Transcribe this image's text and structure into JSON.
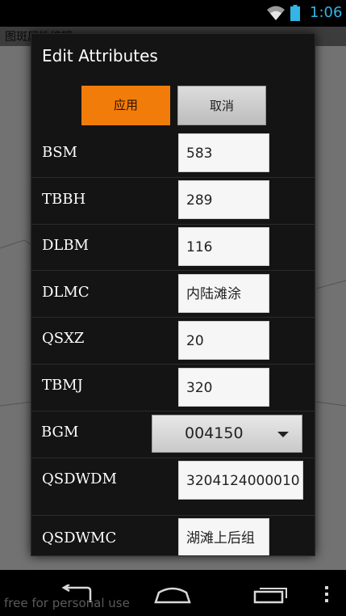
{
  "status_bar": {
    "time": "1:06",
    "icons": [
      "wifi-icon",
      "battery-icon"
    ]
  },
  "background_app": {
    "title": "图斑属性编辑"
  },
  "dialog": {
    "title": "Edit Attributes",
    "apply_label": "应用",
    "cancel_label": "取消",
    "fields": [
      {
        "label": "BSM",
        "value": "583"
      },
      {
        "label": "TBBH",
        "value": "289"
      },
      {
        "label": "DLBM",
        "value": "116"
      },
      {
        "label": "DLMC",
        "value": "内陆滩涂"
      },
      {
        "label": "QSXZ",
        "value": "20"
      },
      {
        "label": "TBMJ",
        "value": "320"
      },
      {
        "label": "BGM",
        "value": "004150"
      },
      {
        "label": "QSDWDM",
        "value": "3204124000010"
      },
      {
        "label": "QSDWMC",
        "value": "湖滩上后组"
      }
    ]
  },
  "nav_bar": {
    "watermark": "free for personal use",
    "icons": [
      "back-icon",
      "home-icon",
      "recent-apps-icon",
      "overflow-menu-icon"
    ]
  },
  "colors": {
    "accent": "#f27c0a",
    "clock": "#33b5e5",
    "dialog_bg": "#141414"
  }
}
